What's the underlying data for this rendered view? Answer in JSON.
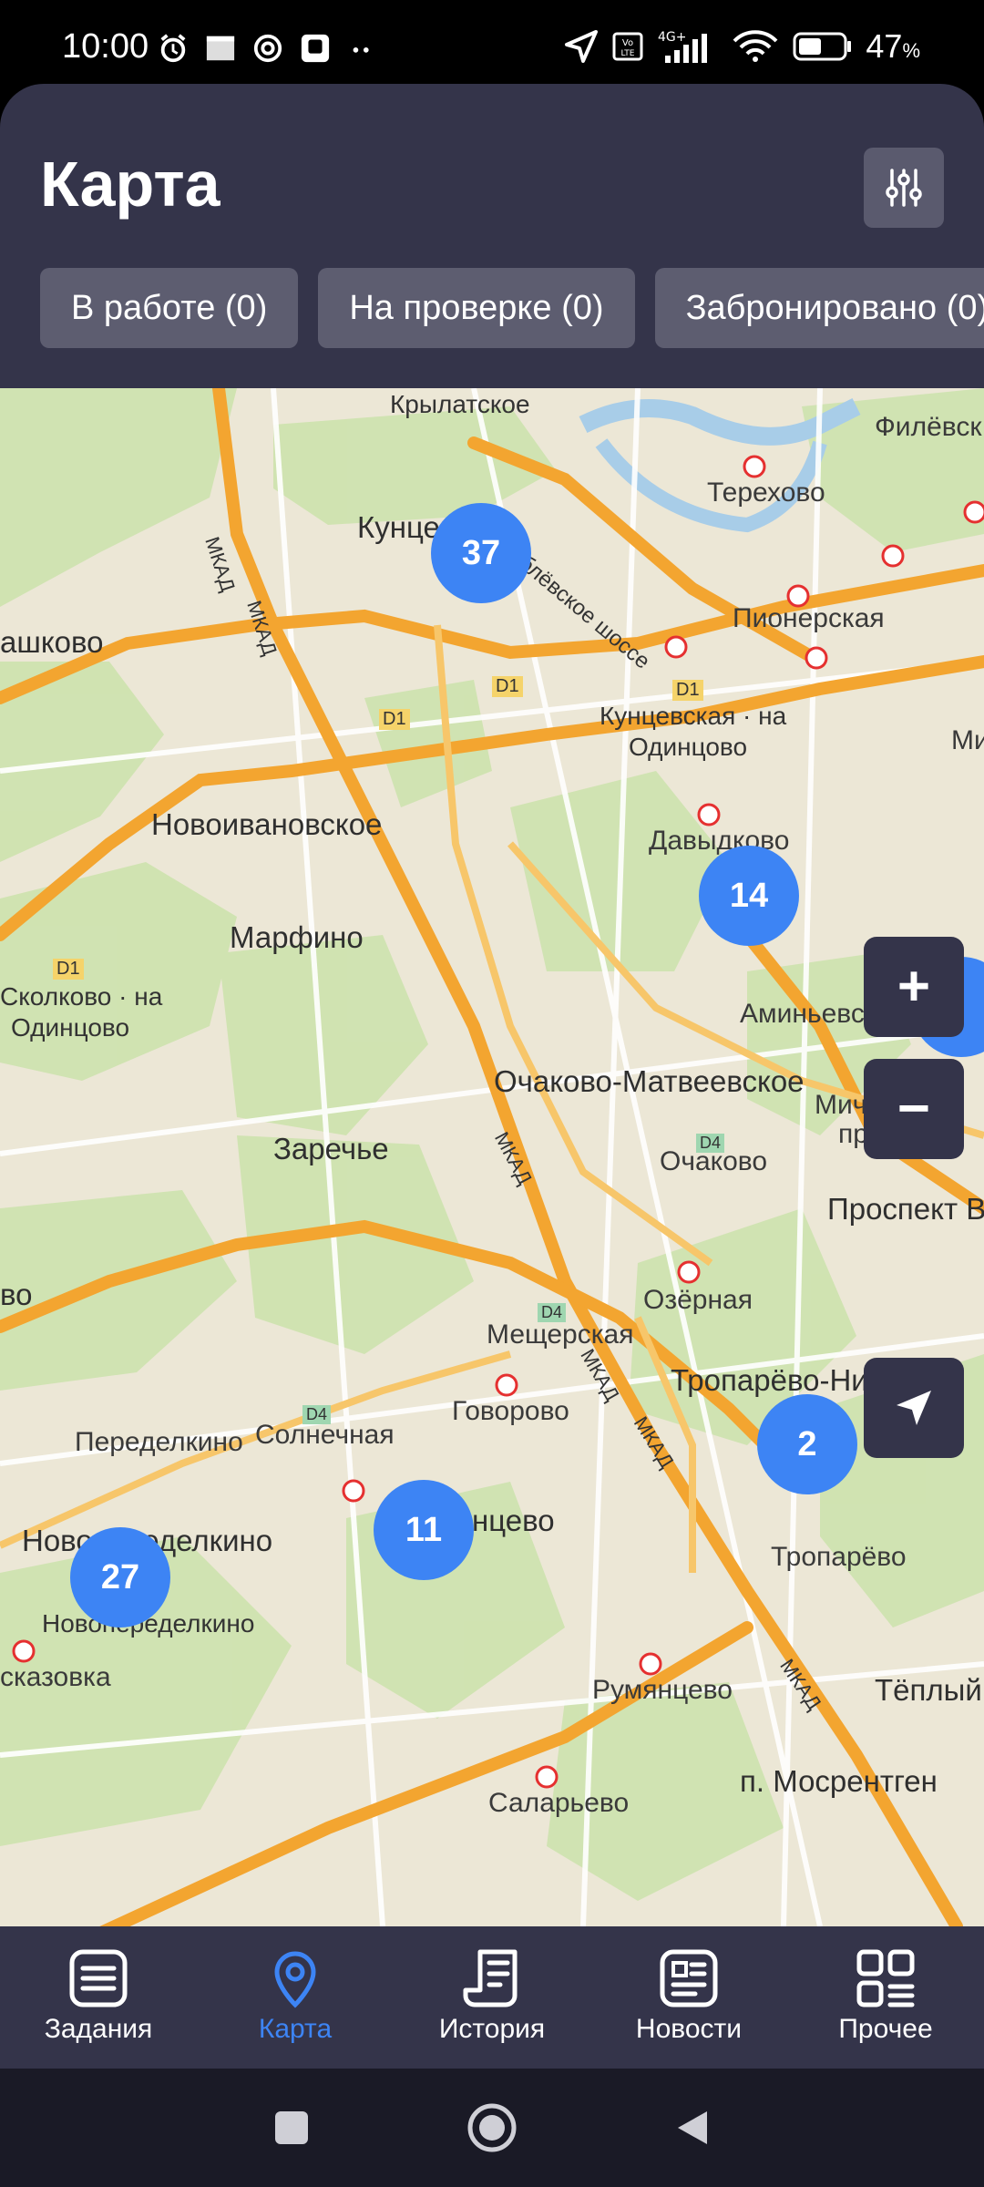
{
  "status_bar": {
    "time": "10:00",
    "battery_pct": "47",
    "battery_symbol": "%",
    "network": "4G+"
  },
  "header": {
    "title": "Карта",
    "chips": [
      {
        "label": "В работе (0)"
      },
      {
        "label": "На проверке (0)"
      },
      {
        "label": "Забронировано (0)"
      }
    ]
  },
  "map": {
    "labels": {
      "krylatskoe": "Крылатское",
      "filevskiy": "Филёвск",
      "terekhovo": "Терехово",
      "kuntsevo_top": "Кунцев",
      "rublevskoe": "Рублёвское шоссе",
      "mkad1": "МКАД",
      "mkad2": "МКАД",
      "pionerskaya": "Пионерская",
      "rashkovo": "ашково",
      "d1a": "D1",
      "d1b": "D1",
      "d1c": "D1",
      "kuntsevskaya": "Кунцевская · на",
      "odintsovo1": "Одинцово",
      "mi": "Ми",
      "novoivanovskoe": "Новоивановское",
      "davydkovo": "Давыдково",
      "marfino": "Марфино",
      "d1d": "D1",
      "skolkovo": "Сколково · на",
      "odintsovo2": "Одинцово",
      "aminyevskaya": "Аминьевска",
      "ochakovo_matveevskoe": "Очаково-Матвеевское",
      "mich": "Мич",
      "pr": "пр",
      "zarechye": "Заречье",
      "mkad3": "МКАД",
      "d4a": "D4",
      "ochakovo": "Очаково",
      "prospekt_ve": "Проспект Ве",
      "vo": "во",
      "ozernaya": "Озёрная",
      "d4b": "D4",
      "meshcherskaya": "Мещерская",
      "troparevo_nik": "Тропарёво-Ник",
      "mkad4": "МКАД",
      "peredelkino": "Переделкино",
      "d4c": "D4",
      "solnechnaya": "Солнечная",
      "govorovo": "Говорово",
      "mkad5": "МКАД",
      "ntsevo": "нцево",
      "novoperedelkino1": "Новопеределкино",
      "novoperedelkino2": "Новопеределкино",
      "troparevo": "Тропарёво",
      "rasskazovka": "сказовка",
      "rumyantsevo": "Румянцево",
      "mkad6": "МКАД",
      "teply": "Тёплый Ст",
      "salaryevo": "Саларьево",
      "mosrentgen": "п. Мосрентген"
    },
    "clusters": [
      {
        "count": "37"
      },
      {
        "count": "14"
      },
      {
        "count": "2"
      },
      {
        "count": "11"
      },
      {
        "count": "27"
      }
    ],
    "zoom_in": "+",
    "zoom_out": "−"
  },
  "bottom_nav": [
    {
      "label": "Задания",
      "icon": "tasks-icon"
    },
    {
      "label": "Карта",
      "icon": "map-pin-icon",
      "active": true
    },
    {
      "label": "История",
      "icon": "history-icon"
    },
    {
      "label": "Новости",
      "icon": "news-icon"
    },
    {
      "label": "Прочее",
      "icon": "grid-icon"
    }
  ],
  "colors": {
    "header_bg": "#34344a",
    "accent": "#3d84f4",
    "chip_bg": "#5d5d70",
    "road": "#f5a623"
  }
}
